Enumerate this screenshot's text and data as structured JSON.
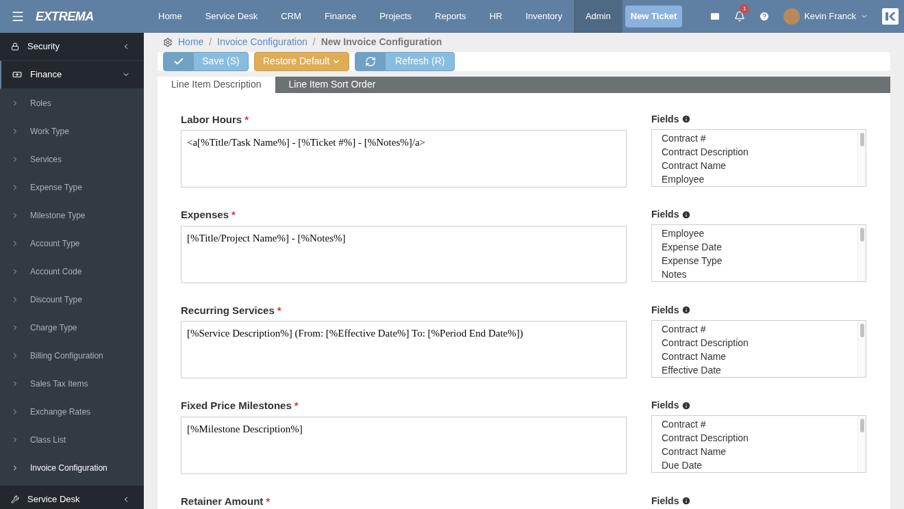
{
  "topbar": {
    "brand": "EXTREMA",
    "nav": [
      {
        "label": "Home",
        "selected": false
      },
      {
        "label": "Service Desk",
        "selected": false
      },
      {
        "label": "CRM",
        "selected": false
      },
      {
        "label": "Finance",
        "selected": false
      },
      {
        "label": "Projects",
        "selected": false
      },
      {
        "label": "Reports",
        "selected": false
      },
      {
        "label": "HR",
        "selected": false
      },
      {
        "label": "Inventory",
        "selected": false
      },
      {
        "label": "Admin",
        "selected": true
      }
    ],
    "new_ticket": "New Ticket",
    "notification_count": "1",
    "user": "Kevin Franck"
  },
  "sidebar": {
    "sections": [
      {
        "label": "Security",
        "expanded": false
      },
      {
        "label": "Finance",
        "expanded": true,
        "items": [
          {
            "label": "Roles",
            "selected": false
          },
          {
            "label": "Work Type",
            "selected": false
          },
          {
            "label": "Services",
            "selected": false
          },
          {
            "label": "Expense Type",
            "selected": false
          },
          {
            "label": "Milestone Type",
            "selected": false
          },
          {
            "label": "Account Type",
            "selected": false
          },
          {
            "label": "Account Code",
            "selected": false
          },
          {
            "label": "Discount Type",
            "selected": false
          },
          {
            "label": "Charge Type",
            "selected": false
          },
          {
            "label": "Billing Configuration",
            "selected": false
          },
          {
            "label": "Sales Tax Items",
            "selected": false
          },
          {
            "label": "Exchange Rates",
            "selected": false
          },
          {
            "label": "Class List",
            "selected": false
          },
          {
            "label": "Invoice Configuration",
            "selected": true
          }
        ]
      },
      {
        "label": "Service Desk",
        "expanded": false
      }
    ]
  },
  "breadcrumb": [
    {
      "label": "Home"
    },
    {
      "separator": "/",
      "label": "Invoice Configuration"
    },
    {
      "separator": "/",
      "label": "New Invoice Configuration"
    }
  ],
  "toolbar": {
    "save": "Save (S)",
    "restore": "Restore Default",
    "refresh": "Refresh (R)"
  },
  "tabs": [
    {
      "label": "Line Item Description",
      "selected": true
    },
    {
      "label": "Line Item Sort Order",
      "selected": false
    }
  ],
  "sections": [
    {
      "label": "Labor Hours",
      "required_mark": "*",
      "value": "<a[%Title/Task Name%] - [%Ticket #%] - [%Notes%]/a>",
      "fields_label": "Fields",
      "fields": [
        "Contract #",
        "Contract Description",
        "Contract Name",
        "Employee"
      ]
    },
    {
      "label": "Expenses",
      "required_mark": "*",
      "value": "[%Title/Project Name%] - [%Notes%]",
      "fields_label": "Fields",
      "fields": [
        "Employee",
        "Expense Date",
        "Expense Type",
        "Notes"
      ]
    },
    {
      "label": "Recurring Services",
      "required_mark": "*",
      "value": "[%Service Description%] (From: [%Effective Date%] To: [%Period End Date%])",
      "fields_label": "Fields",
      "fields": [
        "Contract #",
        "Contract Description",
        "Contract Name",
        "Effective Date"
      ]
    },
    {
      "label": "Fixed Price Milestones",
      "required_mark": "*",
      "value": "[%Milestone Description%]",
      "fields_label": "Fields",
      "fields": [
        "Contract #",
        "Contract Description",
        "Contract Name",
        "Due Date"
      ]
    },
    {
      "label": "Retainer Amount",
      "required_mark": "*",
      "fields_label": "Fields"
    }
  ]
}
